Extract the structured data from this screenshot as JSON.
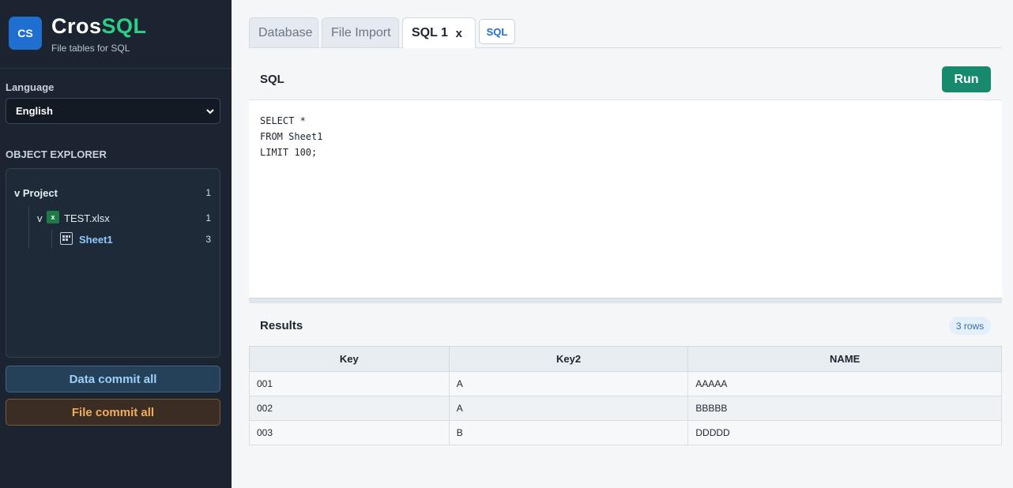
{
  "brand": {
    "badge": "CS",
    "name_part1": "Cros",
    "name_part2": "SQL",
    "subtitle": "File tables for SQL"
  },
  "language": {
    "label": "Language",
    "selected": "English"
  },
  "object_explorer": {
    "label": "OBJECT EXPLORER",
    "project": {
      "toggle": "v",
      "name": "Project",
      "count": "1"
    },
    "file": {
      "toggle": "v",
      "icon_text": "x",
      "name": "TEST.xlsx",
      "count": "1"
    },
    "sheet": {
      "name": "Sheet1",
      "count": "3"
    }
  },
  "actions": {
    "data_commit": "Data commit all",
    "file_commit": "File commit all"
  },
  "tabs": {
    "database": "Database",
    "file_import": "File Import",
    "sql1": "SQL 1",
    "sql1_close": "x",
    "new_sql": "SQL"
  },
  "sql_panel": {
    "title": "SQL",
    "run": "Run",
    "query": "SELECT *\nFROM Sheet1\nLIMIT 100;"
  },
  "results": {
    "title": "Results",
    "rows_badge": "3 rows",
    "columns": [
      "Key",
      "Key2",
      "NAME"
    ],
    "rows": [
      [
        "001",
        "A",
        "AAAAA"
      ],
      [
        "002",
        "A",
        "BBBBB"
      ],
      [
        "003",
        "B",
        "DDDDD"
      ]
    ]
  },
  "colors": {
    "sidebar_bg": "#1b2430",
    "accent_blue": "#1f6fd1",
    "accent_green": "#2ecf84",
    "run_green": "#178a6d",
    "file_commit_orange": "#f0ad5e"
  }
}
